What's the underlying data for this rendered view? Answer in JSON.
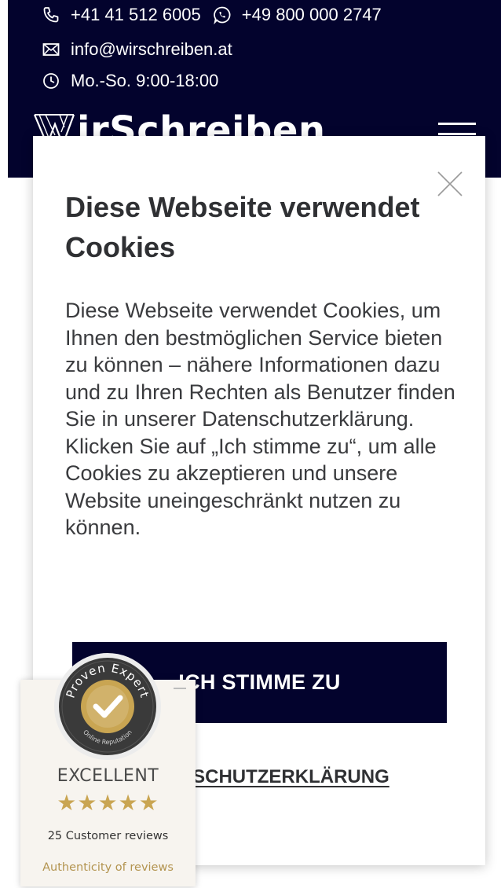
{
  "header": {
    "phone_ch": "+41 41 512 6005",
    "phone_whatsapp": "+49 800 000 2747",
    "email": "info@wirschreiben.at",
    "hours": "Mo.-So. 9:00-18:00",
    "logo_text": "irSchreiben",
    "colors": {
      "background": "#03032d",
      "text": "#ffffff"
    }
  },
  "cookie_dialog": {
    "title": "Diese Webseite verwendet Cookies",
    "body": "Diese Webseite verwendet Cookies, um Ihnen den bestmöglichen Service bieten zu können – nähere Informationen dazu und zu Ihren Rechten als Benutzer finden Sie in unserer Datenschutzerklärung. Klicken Sie auf „Ich stimme zu“, um alle Cookies zu akzeptieren und unsere Website uneingeschränkt nutzen zu können.",
    "accept_label": "ICH STIMME ZU",
    "privacy_label": "DATENSCHUTZERKLÄRUNG",
    "close_icon": "close-icon"
  },
  "proven_expert": {
    "seal_text_top": "Proven Expert",
    "seal_text_bottom": "Online Reputation",
    "rating_label": "EXCELLENT",
    "stars": "★★★★★",
    "reviews": "25 Customer reviews",
    "authenticity": "Authenticity of reviews",
    "colors": {
      "gold": "#c9a552",
      "background": "#f7f4ef"
    }
  }
}
